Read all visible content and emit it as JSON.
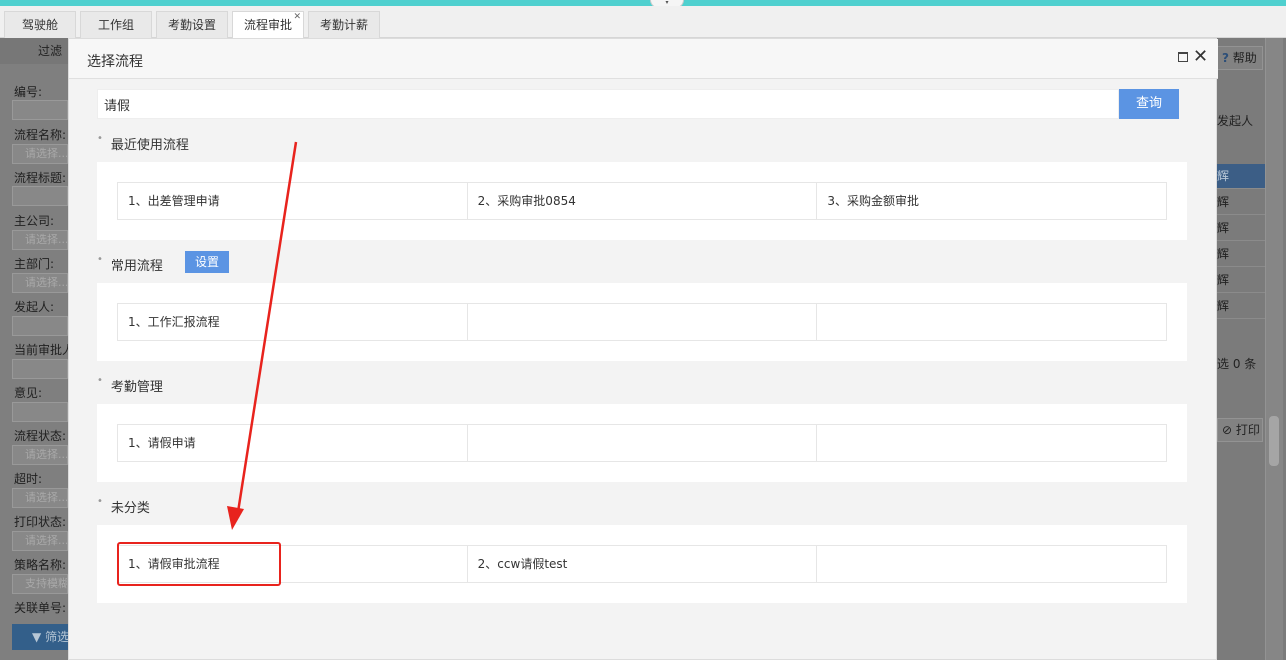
{
  "tabs": [
    {
      "label": "驾驶舱"
    },
    {
      "label": "工作组"
    },
    {
      "label": "考勤设置"
    },
    {
      "label": "流程审批",
      "close": "✕"
    },
    {
      "label": "考勤计薪"
    }
  ],
  "filter": {
    "header": "过滤",
    "fields": [
      {
        "label": "编号:",
        "placeholder": ""
      },
      {
        "label": "流程名称:",
        "placeholder": "请选择..."
      },
      {
        "label": "流程标题:",
        "placeholder": ""
      },
      {
        "label": "主公司:",
        "placeholder": "请选择..."
      },
      {
        "label": "主部门:",
        "placeholder": "请选择..."
      },
      {
        "label": "发起人:",
        "placeholder": ""
      },
      {
        "label": "当前审批人:",
        "placeholder": ""
      },
      {
        "label": "意见:",
        "placeholder": ""
      },
      {
        "label": "流程状态:",
        "placeholder": "请选择..."
      },
      {
        "label": "超时:",
        "placeholder": "请选择..."
      },
      {
        "label": "打印状态:",
        "placeholder": "请选择..."
      },
      {
        "label": "策略名称:",
        "placeholder": "支持模糊"
      },
      {
        "label": "关联单号:",
        "placeholder": ""
      }
    ],
    "button": "筛选"
  },
  "right": {
    "help": "帮助",
    "col_header": "发起人",
    "rows": [
      "辉",
      "辉",
      "辉",
      "辉",
      "辉",
      "辉"
    ],
    "selected_count": "选 0 条",
    "print": "打印"
  },
  "dialog": {
    "title": "选择流程",
    "search_value": "请假",
    "search_button": "查询",
    "sections": [
      {
        "title": "最近使用流程",
        "items": [
          "1、出差管理申请",
          "2、采购审批0854",
          "3、采购金额审批"
        ]
      },
      {
        "title": "常用流程",
        "setting": "设置",
        "items": [
          "1、工作汇报流程",
          "",
          ""
        ]
      },
      {
        "title": "考勤管理",
        "items": [
          "1、请假申请",
          "",
          ""
        ]
      },
      {
        "title": "未分类",
        "items": [
          "1、请假审批流程",
          "2、ccw请假test",
          ""
        ]
      }
    ]
  },
  "colors": {
    "accent": "#5b94e3",
    "annotation": "#e8231d",
    "topbar": "#4fd0cf"
  }
}
